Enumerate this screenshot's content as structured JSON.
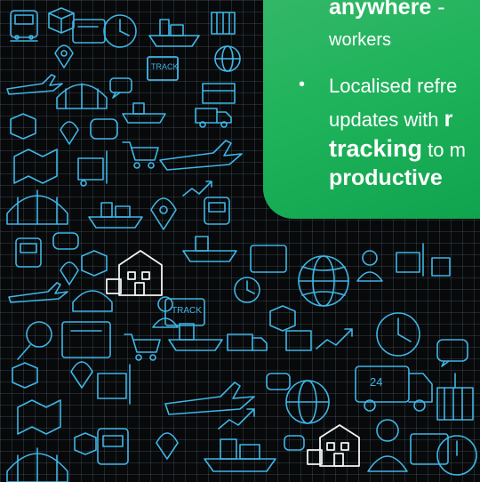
{
  "card": {
    "line1_bold": "anywhere",
    "line1_rest": " -",
    "line2": "workers",
    "bullet_symbol": "•",
    "bullet_line1": "Localised refre",
    "bullet_line2_pre": "updates with ",
    "bullet_line2_bold": "r",
    "bullet_line3_bold": "tracking",
    "bullet_line3_rest": " to m",
    "bullet_line4_bold": "productive"
  },
  "illustration": {
    "sign_text": "TRACK",
    "clock_text": "24",
    "icons": [
      "airplane-icon",
      "ship-icon",
      "truck-icon",
      "train-icon",
      "map-pin-icon",
      "globe-icon",
      "clock-icon",
      "box-icon",
      "warehouse-icon",
      "shopping-cart-icon",
      "chat-bubble-icon",
      "magnifier-icon",
      "forklift-icon",
      "container-icon",
      "tablet-icon",
      "person-icon",
      "house-icon"
    ],
    "colors": {
      "line": "#3fb6e6",
      "white": "#f2f5f5",
      "card": "#1fb35b"
    }
  }
}
